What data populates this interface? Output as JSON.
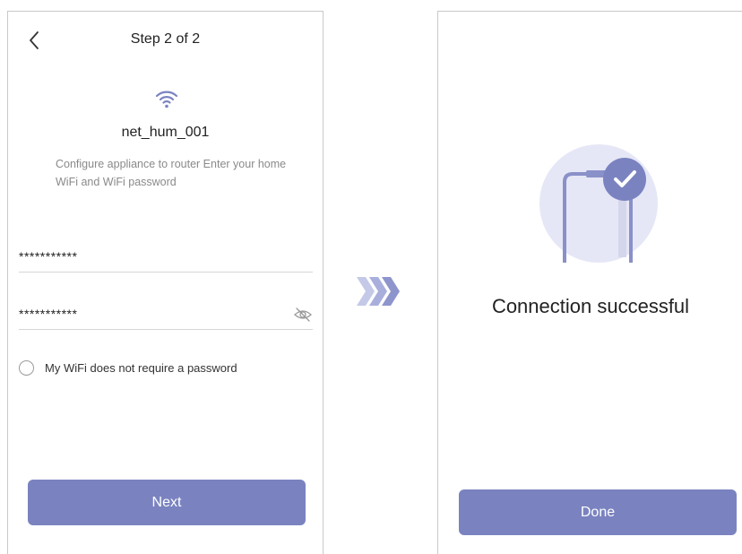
{
  "colors": {
    "accent": "#7a83c0",
    "accent_light": "#e6e7f6",
    "border": "#c9c9c9"
  },
  "left_screen": {
    "header": {
      "title": "Step 2 of 2",
      "back_icon": "chevron-left-icon"
    },
    "wifi_icon": "wifi-icon",
    "network_name": "net_hum_001",
    "description": "Configure appliance to router Enter your home WiFi and WiFi password",
    "ssid_field": {
      "value": "***********"
    },
    "password_field": {
      "value": "***********",
      "toggle_icon": "eye-slash-icon"
    },
    "no_password_option": {
      "label": "My WiFi does not require a password",
      "checked": false
    },
    "next_button": "Next"
  },
  "transition_icon": "triple-chevron-right-icon",
  "right_screen": {
    "illustration_icon": "phone-check-icon",
    "message": "Connection successful",
    "done_button": "Done"
  }
}
